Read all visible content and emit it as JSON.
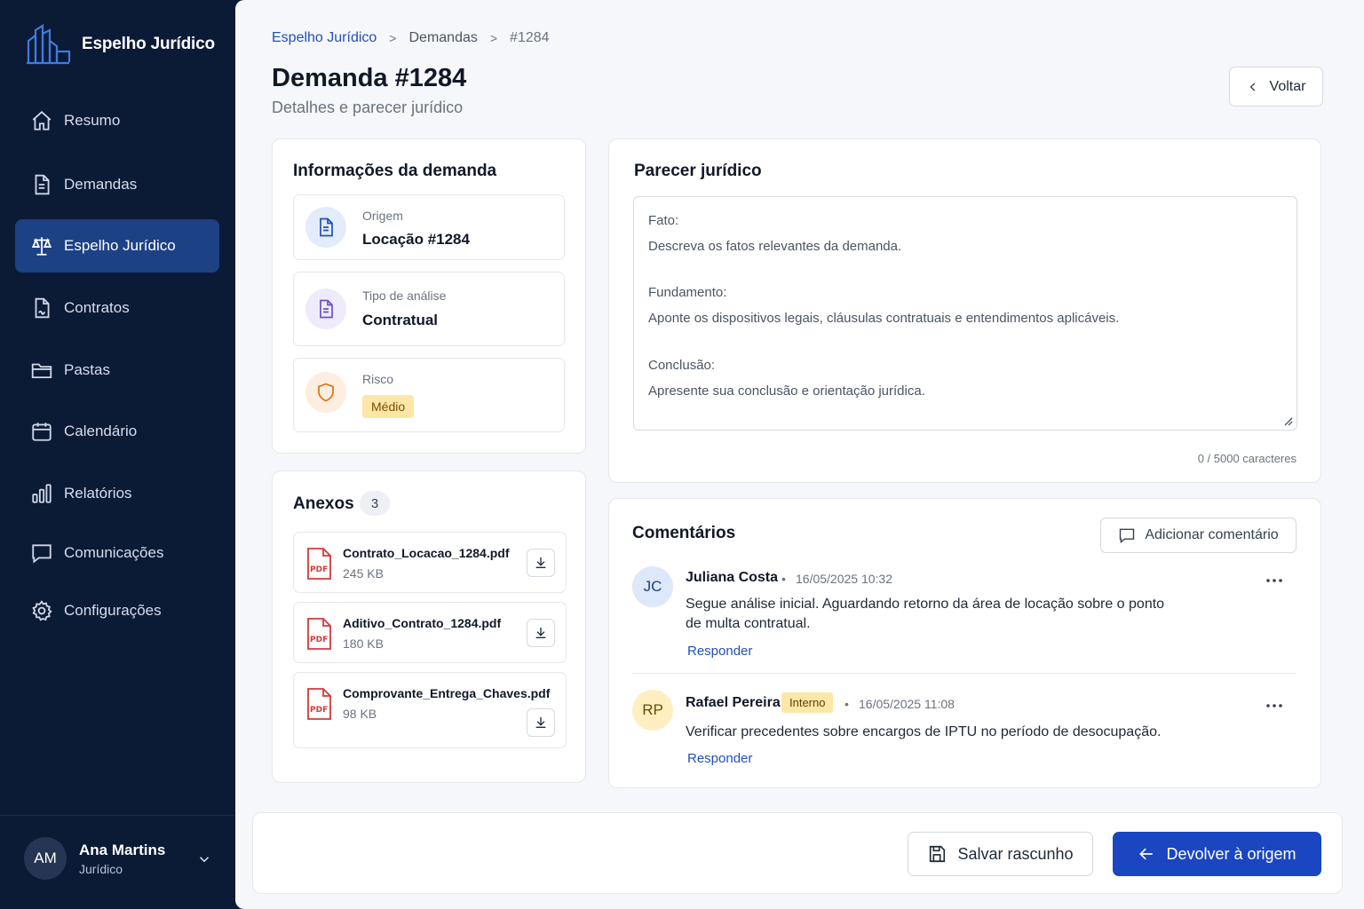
{
  "brand": {
    "name": "Espelho Jurídico"
  },
  "nav": [
    {
      "label": "Resumo",
      "icon": "home-icon"
    },
    {
      "label": "Demandas",
      "icon": "document-icon"
    },
    {
      "label": "Espelho Jurídico",
      "icon": "scale-icon",
      "active": true
    },
    {
      "label": "Contratos",
      "icon": "contract-icon"
    },
    {
      "label": "Pastas",
      "icon": "folder-icon"
    },
    {
      "label": "Calendário",
      "icon": "calendar-icon"
    },
    {
      "label": "Relatórios",
      "icon": "bar-chart-icon"
    },
    {
      "label": "Comunicações",
      "icon": "chat-icon"
    },
    {
      "label": "Configurações",
      "icon": "gear-icon"
    }
  ],
  "user": {
    "initials": "AM",
    "name": "Ana Martins",
    "role": "Jurídico"
  },
  "breadcrumb": {
    "items": [
      "Espelho Jurídico",
      "Demandas",
      "#1284"
    ],
    "separator": ">"
  },
  "page": {
    "title": "Demanda #1284",
    "subtitle": "Detalhes e parecer jurídico",
    "back_label": "Voltar"
  },
  "info": {
    "title": "Informações da demanda",
    "origem_label": "Origem",
    "origem_value": "Locação #1284",
    "tipo_label": "Tipo de análise",
    "tipo_value": "Contratual",
    "risco_label": "Risco",
    "risco_value": "Médio"
  },
  "anexos": {
    "title": "Anexos",
    "count": "3",
    "pdf_label": "PDF",
    "files": [
      {
        "name": "Contrato_Locacao_1284.pdf",
        "size": "245 KB"
      },
      {
        "name": "Aditivo_Contrato_1284.pdf",
        "size": "180 KB"
      },
      {
        "name": "Comprovante_Entrega_Chaves.pdf",
        "size": "98 KB"
      }
    ]
  },
  "parecer": {
    "title": "Parecer jurídico",
    "fato_label": "Fato:",
    "fato_placeholder": "Descreva os fatos relevantes da demanda.",
    "fundamento_label": "Fundamento:",
    "fundamento_placeholder": "Aponte os dispositivos legais, cláusulas contratuais e entendimentos aplicáveis.",
    "conclusao_label": "Conclusão:",
    "conclusao_placeholder": "Apresente sua conclusão e orientação jurídica.",
    "char_count": "0 / 5000 caracteres"
  },
  "comentarios": {
    "title": "Comentários",
    "add_label": "Adicionar comentário",
    "items": [
      {
        "initials": "JC",
        "author": "Juliana Costa",
        "tag": "",
        "date": "16/05/2025 10:32",
        "text": "Segue análise inicial. Aguardando retorno da área de locação sobre o ponto de multa contratual.",
        "reply": "Responder"
      },
      {
        "initials": "RP",
        "author": "Rafael Pereira",
        "tag": "Interno",
        "date": "16/05/2025 11:08",
        "text": "Verificar precedentes sobre encargos de IPTU no período de desocupação.",
        "reply": "Responder"
      }
    ]
  },
  "actions": {
    "save_label": "Salvar rascunho",
    "return_label": "Devolver à origem"
  },
  "colors": {
    "sidebar": "#0b1a35",
    "active_nav": "#1d4185",
    "primary": "#1b46c2",
    "link": "#2150b8",
    "warning_badge": "#fde7a6"
  }
}
